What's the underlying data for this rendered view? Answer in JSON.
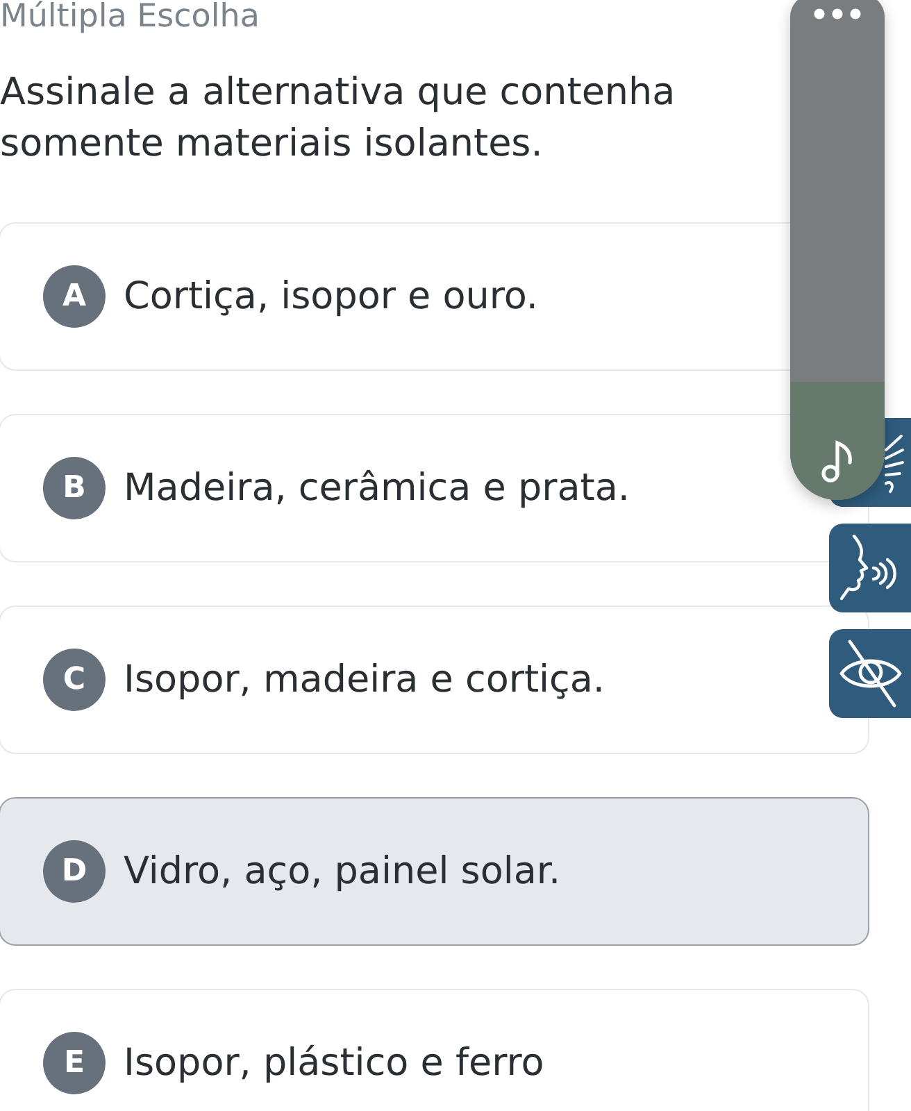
{
  "header": {
    "title": "Múltipla Escolha"
  },
  "question": "Assinale a alternativa que contenha somente materiais isolantes.",
  "options": [
    {
      "letter": "A",
      "text": "Cortiça, isopor e ouro.",
      "selected": false
    },
    {
      "letter": "B",
      "text": "Madeira, cerâmica e prata.",
      "selected": false
    },
    {
      "letter": "C",
      "text": "Isopor, madeira e cortiça.",
      "selected": false
    },
    {
      "letter": "D",
      "text": "Vidro, aço, painel solar.",
      "selected": true
    },
    {
      "letter": "E",
      "text": "Isopor, plástico e ferro",
      "selected": false
    }
  ]
}
